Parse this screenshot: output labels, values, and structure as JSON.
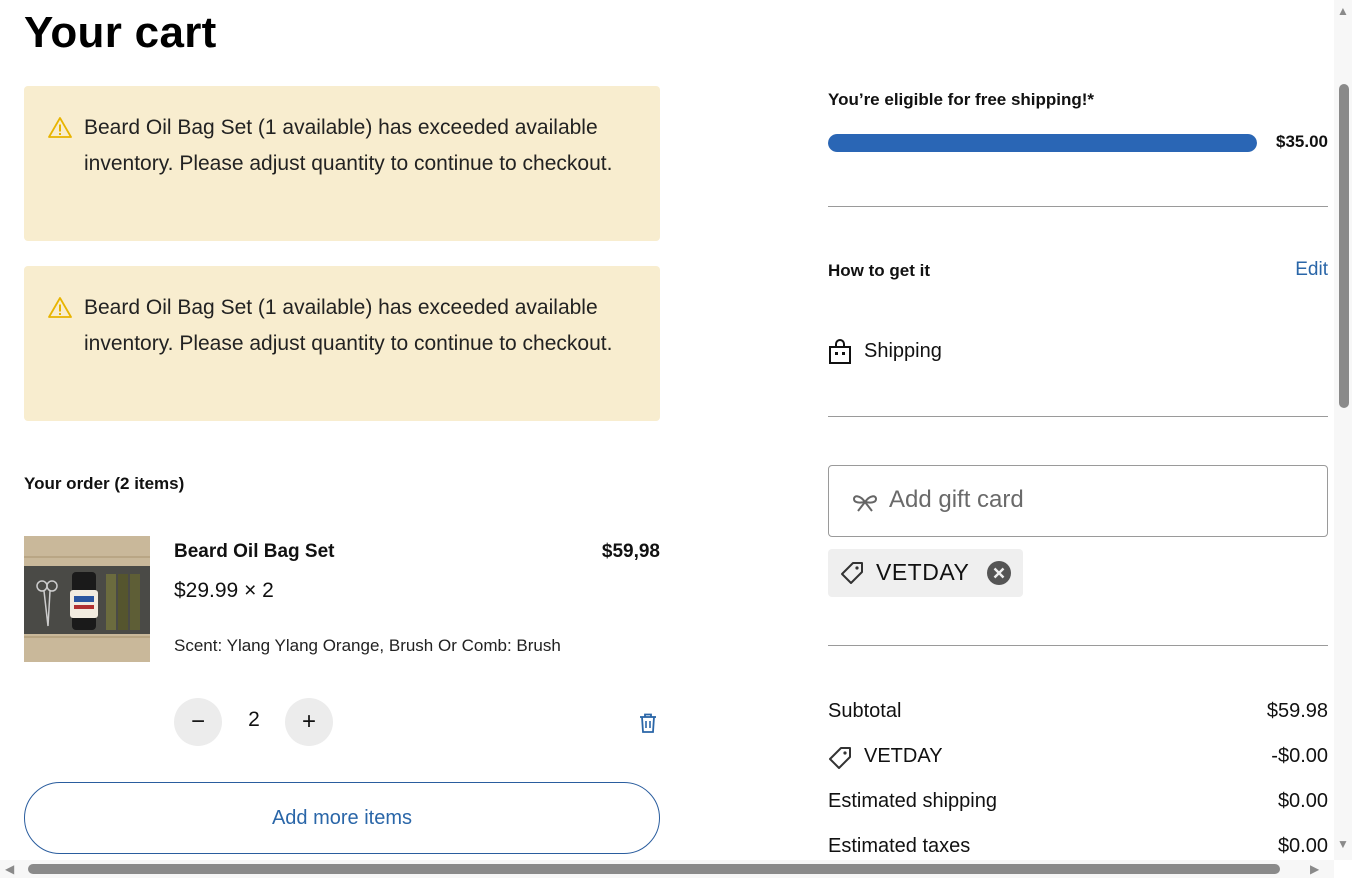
{
  "page": {
    "title": "Your cart"
  },
  "alerts": [
    {
      "icon": "warning-icon",
      "text": "Beard Oil Bag Set (1 available) has exceeded available inventory. Please adjust quantity to continue to checkout."
    },
    {
      "icon": "warning-icon",
      "text": "Beard Oil Bag Set (1 available) has exceeded available inventory. Please adjust quantity to continue to checkout."
    }
  ],
  "order": {
    "heading": "Your order (2 items)",
    "items": [
      {
        "name": "Beard Oil Bag Set",
        "unit_price_qty": "$29.99 × 2",
        "line_total": "$59,98",
        "variant": "Scent: Ylang Ylang Orange, Brush Or Comb: Brush",
        "quantity": "2",
        "decrement_label": "−",
        "increment_label": "+"
      }
    ],
    "add_more_label": "Add more items"
  },
  "shipping_progress": {
    "message": "You’re eligible for free shipping!*",
    "threshold": "$35.00",
    "progress_fraction": 1.0
  },
  "fulfillment": {
    "title": "How to get it",
    "edit_label": "Edit",
    "method_label": "Shipping"
  },
  "gift_card": {
    "placeholder": "Add gift card"
  },
  "discount": {
    "code": "VETDAY"
  },
  "summary": {
    "subtotal_label": "Subtotal",
    "subtotal_value": "$59.98",
    "discount_label": "VETDAY",
    "discount_value": "-$0.00",
    "shipping_label": "Estimated shipping",
    "shipping_value": "$0.00",
    "taxes_label": "Estimated taxes",
    "taxes_value": "$0.00"
  },
  "colors": {
    "alert_bg": "#f8edcf",
    "warning_icon": "#e8b400",
    "progress": "#2a66b5",
    "link": "#2a66a8"
  }
}
